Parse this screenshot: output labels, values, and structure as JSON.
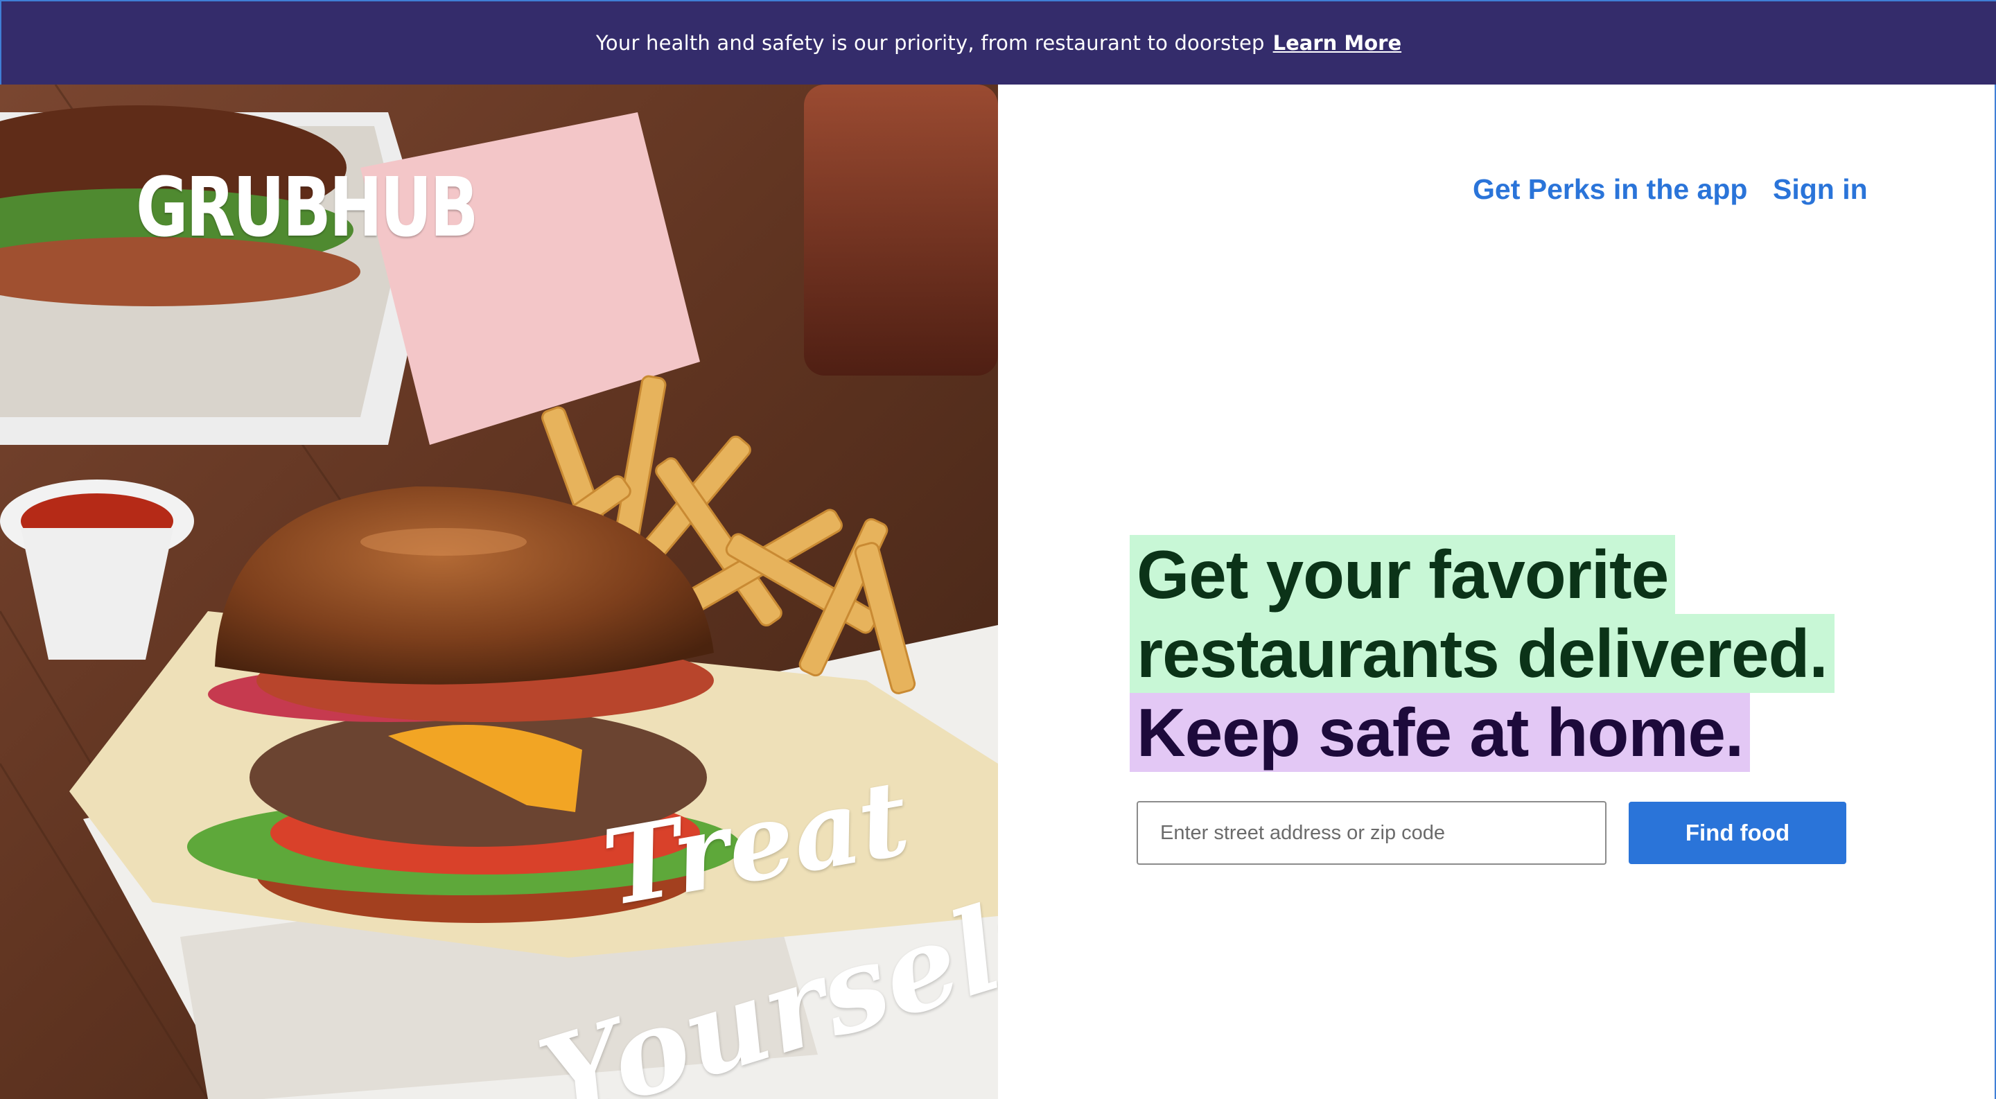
{
  "banner": {
    "message": "Your health and safety is our priority, from restaurant to doorstep",
    "link_label": "Learn More"
  },
  "hero": {
    "logo": "GRUBHUB",
    "script_line1": "Treat",
    "script_line2": "Yourself"
  },
  "nav": {
    "perks_label": "Get Perks in the app",
    "signin_label": "Sign in"
  },
  "headline": {
    "line1": "Get your favorite",
    "line2": "restaurants delivered.",
    "line3": "Keep safe at home."
  },
  "search": {
    "placeholder": "Enter street address or zip code",
    "value": "",
    "button_label": "Find food"
  },
  "colors": {
    "banner_bg": "#342c6b",
    "accent_blue": "#2a74d9",
    "highlight_green": "#c8f7d6",
    "highlight_purple": "#e3c8f5"
  }
}
